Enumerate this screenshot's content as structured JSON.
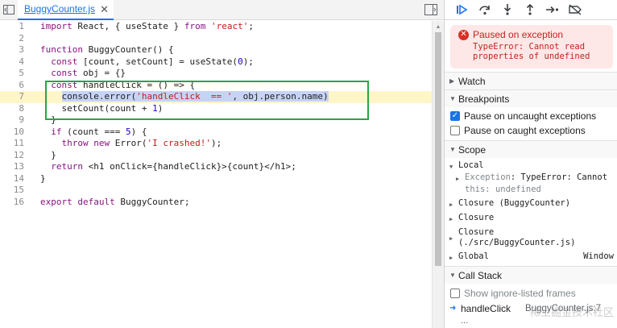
{
  "editor": {
    "tab_label": "BuggyCounter.js",
    "close_glyph": "✕",
    "lines": [
      {
        "n": "1",
        "t": "import React, { useState } from 'react';"
      },
      {
        "n": "2",
        "t": ""
      },
      {
        "n": "3",
        "t": "function BuggyCounter() {"
      },
      {
        "n": "4",
        "t": "  const [count, setCount] = useState(0);"
      },
      {
        "n": "5",
        "t": "  const obj = {}"
      },
      {
        "n": "6",
        "t": "  const handleClick = () => {"
      },
      {
        "n": "7",
        "t": "    console.error('handleClick  == ', obj.person.name)"
      },
      {
        "n": "8",
        "t": "    setCount(count + 1)"
      },
      {
        "n": "9",
        "t": "  }"
      },
      {
        "n": "10",
        "t": "  if (count === 5) {"
      },
      {
        "n": "11",
        "t": "    throw new Error('I crashed!');"
      },
      {
        "n": "12",
        "t": "  }"
      },
      {
        "n": "13",
        "t": "  return <h1 onClick={handleClick}>{count}</h1>;"
      },
      {
        "n": "14",
        "t": "}"
      },
      {
        "n": "15",
        "t": ""
      },
      {
        "n": "16",
        "t": "export default BuggyCounter;"
      }
    ],
    "paused_line": 7
  },
  "debugger": {
    "paused_title": "Paused on exception",
    "paused_detail": "TypeError: Cannot read\nproperties of undefined",
    "watch_label": "Watch",
    "breakpoints_label": "Breakpoints",
    "bp_uncaught": "Pause on uncaught exceptions",
    "bp_uncaught_checked": true,
    "bp_caught": "Pause on caught exceptions",
    "bp_caught_checked": false,
    "scope_label": "Scope",
    "local_label": "Local",
    "exception_name": "Exception",
    "exception_value": ": TypeError: Cannot",
    "this_name": "this",
    "this_value": ": undefined",
    "closure1": "Closure (BuggyCounter)",
    "closure2": "Closure",
    "closure3_line1": "Closure",
    "closure3_line2": "(./src/BuggyCounter.js)",
    "global_label": "Global",
    "global_value": "Window",
    "callstack_label": "Call Stack",
    "show_ignore": "Show ignore-listed frames",
    "cs_fn": "handleClick",
    "cs_loc": "BuggyCounter.js:7",
    "cs_next": "...",
    "watermark": "稀土掘金技术社区"
  },
  "icons": {
    "resume": "resume-icon",
    "step_over": "step-over-icon",
    "step_into": "step-into-icon",
    "step_out": "step-out-icon",
    "step": "step-icon",
    "deactivate": "deactivate-breakpoints-icon"
  },
  "colors": {
    "accent": "#1a73e8",
    "paused_line_bg": "#fff6c8",
    "selection": "#c6d3f5",
    "highlight_box": "#27a545",
    "error": "#c5221f"
  }
}
